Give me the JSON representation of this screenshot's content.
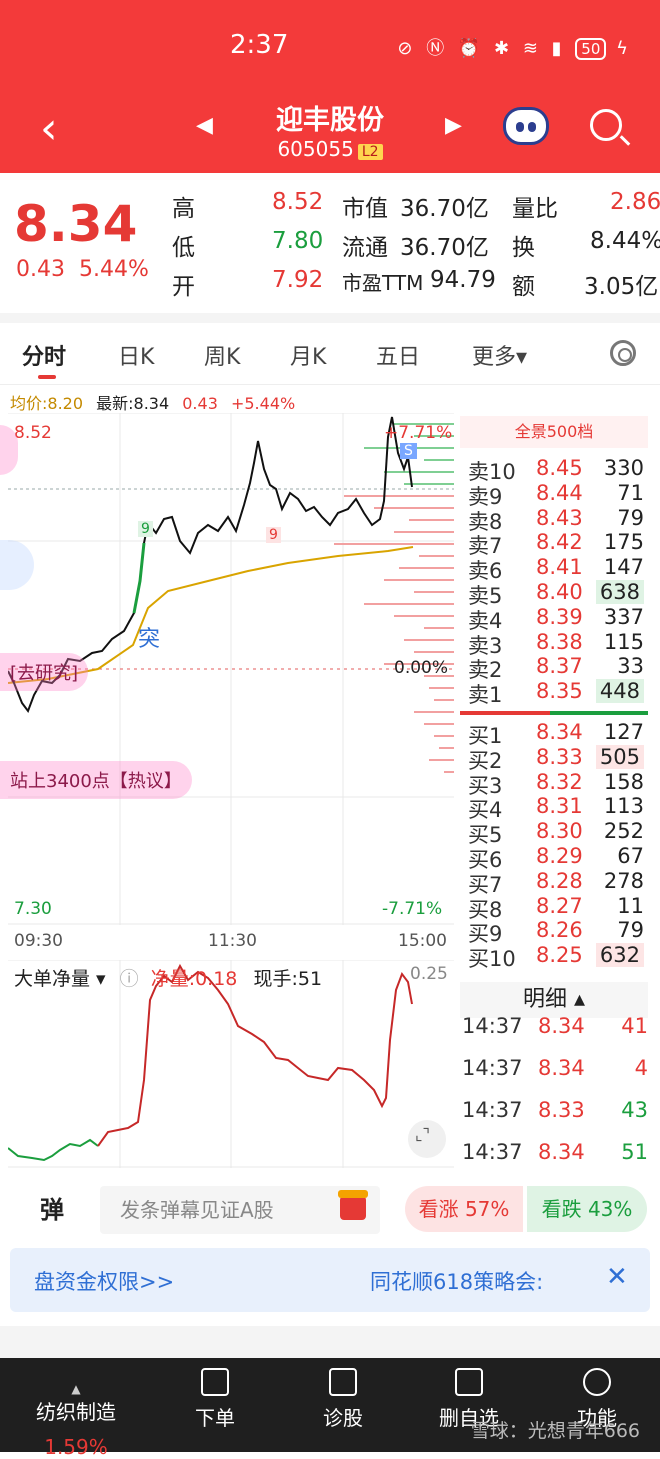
{
  "status": {
    "time": "2:37",
    "battery": "50"
  },
  "nav": {
    "stock_name": "迎丰股份",
    "stock_code": "605055",
    "level": "L2"
  },
  "quote": {
    "price": "8.34",
    "change": "0.43",
    "change_pct": "5.44%",
    "high_label": "高",
    "high": "8.52",
    "low_label": "低",
    "low": "7.80",
    "open_label": "开",
    "open": "7.92",
    "mktcap_label": "市值",
    "mktcap": "36.70亿",
    "float_label": "流通",
    "float": "36.70亿",
    "pe_label": "市盈TTM",
    "pe": "94.79",
    "volratio_label": "量比",
    "volratio": "2.86",
    "turnover_label": "换",
    "turnover": "8.44%",
    "amount_label": "额",
    "amount": "3.05亿"
  },
  "tabs": [
    "分时",
    "日K",
    "周K",
    "月K",
    "五日",
    "更多▾"
  ],
  "legend": {
    "avg": "均价:8.20",
    "latest": "最新:8.34",
    "chg": "0.43",
    "pct": "+5.44%"
  },
  "chart": {
    "y_top": "8.52",
    "y_bottom": "7.30",
    "pct_top": "+7.71%",
    "pct_mid": "0.00%",
    "pct_bottom": "-7.71%",
    "x_labels": [
      "09:30",
      "11:30",
      "15:00"
    ],
    "marker_s": "S",
    "marker_9a": "9",
    "marker_9b": "9",
    "marker_tu": "突",
    "bubble_1": "[去研究]",
    "bubble_2": "站上3400点【热议】"
  },
  "order_book": {
    "title": "全景500档",
    "sell": [
      {
        "lv": "卖10",
        "price": "8.45",
        "vol": "330"
      },
      {
        "lv": "卖9",
        "price": "8.44",
        "vol": "71"
      },
      {
        "lv": "卖8",
        "price": "8.43",
        "vol": "79"
      },
      {
        "lv": "卖7",
        "price": "8.42",
        "vol": "175"
      },
      {
        "lv": "卖6",
        "price": "8.41",
        "vol": "147"
      },
      {
        "lv": "卖5",
        "price": "8.40",
        "vol": "638"
      },
      {
        "lv": "卖4",
        "price": "8.39",
        "vol": "337"
      },
      {
        "lv": "卖3",
        "price": "8.38",
        "vol": "115"
      },
      {
        "lv": "卖2",
        "price": "8.37",
        "vol": "33"
      },
      {
        "lv": "卖1",
        "price": "8.35",
        "vol": "448"
      }
    ],
    "buy": [
      {
        "lv": "买1",
        "price": "8.34",
        "vol": "127"
      },
      {
        "lv": "买2",
        "price": "8.33",
        "vol": "505"
      },
      {
        "lv": "买3",
        "price": "8.32",
        "vol": "158"
      },
      {
        "lv": "买4",
        "price": "8.31",
        "vol": "113"
      },
      {
        "lv": "买5",
        "price": "8.30",
        "vol": "252"
      },
      {
        "lv": "买6",
        "price": "8.29",
        "vol": "67"
      },
      {
        "lv": "买7",
        "price": "8.28",
        "vol": "278"
      },
      {
        "lv": "买8",
        "price": "8.27",
        "vol": "11"
      },
      {
        "lv": "买9",
        "price": "8.26",
        "vol": "79"
      },
      {
        "lv": "买10",
        "price": "8.25",
        "vol": "632"
      }
    ]
  },
  "detail": {
    "title": "明细 ▴",
    "rows": [
      {
        "t": "14:37",
        "p": "8.34",
        "v": "41",
        "dir": "up"
      },
      {
        "t": "14:37",
        "p": "8.34",
        "v": "4",
        "dir": "up"
      },
      {
        "t": "14:37",
        "p": "8.33",
        "v": "43",
        "dir": "down"
      },
      {
        "t": "14:37",
        "p": "8.34",
        "v": "51",
        "dir": "down"
      }
    ]
  },
  "flow": {
    "title": "大单净量 ▾",
    "net_label": "净量:0.18",
    "hand_label": "现手:51",
    "max_label": "0.25"
  },
  "danmu": {
    "icon": "弹",
    "placeholder": "发条弹幕见证A股",
    "bull": "看涨 57%",
    "bear": "看跌 43%"
  },
  "banner": {
    "left": "盘资金权限>>",
    "right": "同花顺618策略会:",
    "close": "✕"
  },
  "bottom": {
    "industry": "纺织制造",
    "industry_change": "1.59%",
    "items": [
      "下单",
      "诊股",
      "删自选",
      "功能"
    ],
    "watermark": "雪球：光想青年666"
  }
}
